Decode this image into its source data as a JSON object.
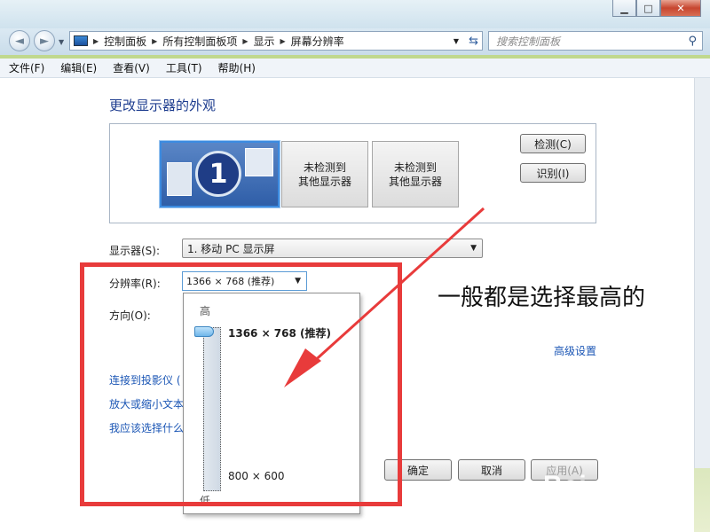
{
  "window": {
    "minimize_glyph": "▁",
    "maximize_glyph": "□",
    "close_glyph": "✕"
  },
  "navigation": {
    "back_glyph": "◄",
    "forward_glyph": "►",
    "breadcrumbs": [
      "控制面板",
      "所有控制面板项",
      "显示",
      "屏幕分辨率"
    ],
    "search_placeholder": "搜索控制面板"
  },
  "menubar": {
    "items": [
      "文件(F)",
      "编辑(E)",
      "查看(V)",
      "工具(T)",
      "帮助(H)"
    ]
  },
  "main": {
    "heading": "更改显示器的外观",
    "monitors": [
      {
        "number": "1",
        "selected": true
      },
      {
        "line1": "未检测到",
        "line2": "其他显示器"
      },
      {
        "line1": "未检测到",
        "line2": "其他显示器"
      }
    ],
    "detect_button": "检测(C)",
    "identify_button": "识别(I)",
    "display_label": "显示器(S):",
    "display_value": "1. 移动 PC 显示屏",
    "resolution_label": "分辨率(R):",
    "resolution_value": "1366 × 768 (推荐)",
    "orientation_label": "方向(O):",
    "advanced_link": "高级设置",
    "links": [
      "连接到投影仪 (",
      "放大或缩小文本",
      "我应该选择什么"
    ]
  },
  "resolution_dropdown": {
    "high_label": "高",
    "low_label": "低",
    "max_option": "1366 × 768 (推荐)",
    "min_option": "800 × 600",
    "slider_level": 1.0
  },
  "dialog_buttons": {
    "ok": "确定",
    "cancel": "取消",
    "apply": "应用(A)"
  },
  "annotation": {
    "text": "一般都是选择最高的",
    "highlight_color": "#e83b3b"
  },
  "watermark": {
    "logo": "Bai du 经验",
    "url": "jingyan.baidu.com"
  }
}
